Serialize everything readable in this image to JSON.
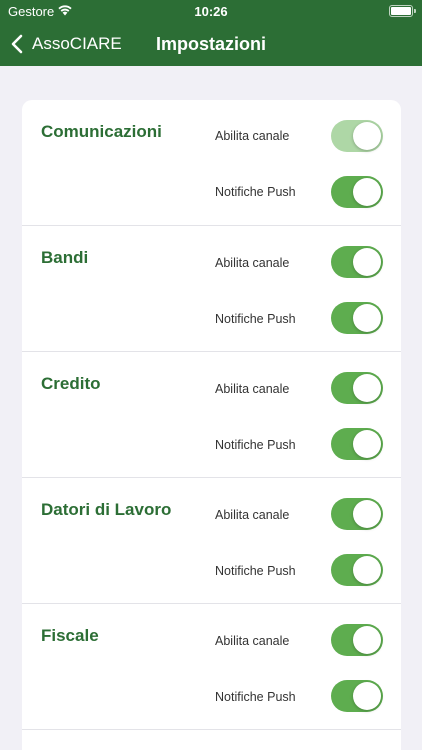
{
  "status_bar": {
    "carrier": "Gestore",
    "time": "10:26"
  },
  "nav": {
    "back_label": "AssoCIARE",
    "title": "Impostazioni"
  },
  "colors": {
    "brand": "#2c6e35",
    "toggle_on": "#5ead4f",
    "toggle_on_dimmed": "#aed7a6",
    "background": "#f1f0f6"
  },
  "sections": [
    {
      "title": "Comunicazioni",
      "rows": [
        {
          "label": "Abilita canale",
          "on": true,
          "dimmed": true
        },
        {
          "label": "Notifiche Push",
          "on": true,
          "dimmed": false
        }
      ]
    },
    {
      "title": "Bandi",
      "rows": [
        {
          "label": "Abilita canale",
          "on": true,
          "dimmed": false
        },
        {
          "label": "Notifiche Push",
          "on": true,
          "dimmed": false
        }
      ]
    },
    {
      "title": "Credito",
      "rows": [
        {
          "label": "Abilita canale",
          "on": true,
          "dimmed": false
        },
        {
          "label": "Notifiche Push",
          "on": true,
          "dimmed": false
        }
      ]
    },
    {
      "title": "Datori di Lavoro",
      "rows": [
        {
          "label": "Abilita canale",
          "on": true,
          "dimmed": false
        },
        {
          "label": "Notifiche Push",
          "on": true,
          "dimmed": false
        }
      ]
    },
    {
      "title": "Fiscale",
      "rows": [
        {
          "label": "Abilita canale",
          "on": true,
          "dimmed": false
        },
        {
          "label": "Notifiche Push",
          "on": true,
          "dimmed": false
        }
      ]
    }
  ]
}
